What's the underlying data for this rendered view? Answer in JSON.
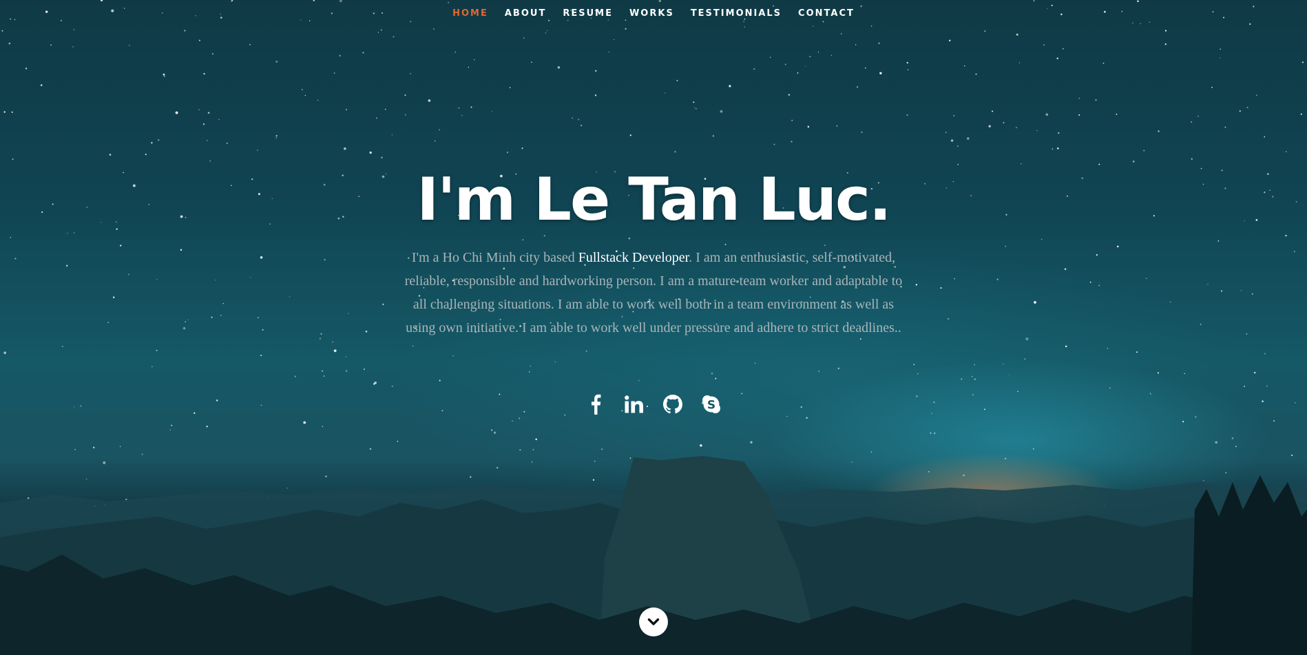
{
  "nav": {
    "items": [
      {
        "label": "HOME",
        "active": true
      },
      {
        "label": "ABOUT",
        "active": false
      },
      {
        "label": "RESUME",
        "active": false
      },
      {
        "label": "WORKS",
        "active": false
      },
      {
        "label": "TESTIMONIALS",
        "active": false
      },
      {
        "label": "CONTACT",
        "active": false
      }
    ],
    "active_color": "#e4662e",
    "color": "#ffffff"
  },
  "hero": {
    "headline": "I'm Le Tan Luc.",
    "intro_before": "I'm a Ho Chi Minh city based ",
    "intro_role": "Fullstack Developer",
    "intro_after": ". I am an enthusiastic, self-motivated, reliable, responsible and hardworking person. I am a mature team worker and adaptable to all challenging situations. I am able to work well both in a team environment as well as using own initiative. I am able to work well under pressure and adhere to strict deadlines..",
    "intro_color": "#a9b5b8",
    "role_color": "#ffffff"
  },
  "social": {
    "icons": [
      "facebook-icon",
      "linkedin-icon",
      "github-icon",
      "skype-icon"
    ]
  },
  "scroll": {
    "icon": "chevron-down-icon"
  }
}
